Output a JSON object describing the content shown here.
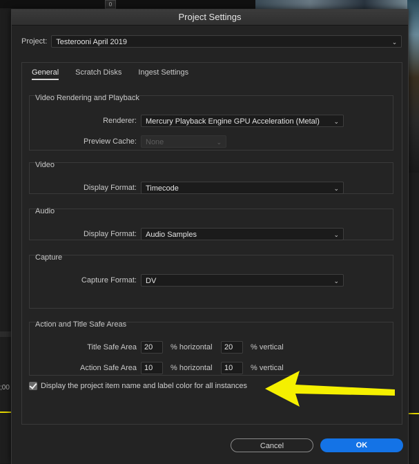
{
  "background": {
    "top_number": "0",
    "left_timecode": ";00"
  },
  "dialog": {
    "title": "Project Settings",
    "project_label": "Project:",
    "project_value": "Testerooni April 2019"
  },
  "tabs": [
    {
      "label": "General",
      "active": true
    },
    {
      "label": "Scratch Disks",
      "active": false
    },
    {
      "label": "Ingest Settings",
      "active": false
    }
  ],
  "video_rendering": {
    "title": "Video Rendering and Playback",
    "renderer_label": "Renderer:",
    "renderer_value": "Mercury Playback Engine GPU Acceleration (Metal)",
    "preview_cache_label": "Preview Cache:",
    "preview_cache_value": "None"
  },
  "video": {
    "title": "Video",
    "display_format_label": "Display Format:",
    "display_format_value": "Timecode"
  },
  "audio": {
    "title": "Audio",
    "display_format_label": "Display Format:",
    "display_format_value": "Audio Samples"
  },
  "capture": {
    "title": "Capture",
    "capture_format_label": "Capture Format:",
    "capture_format_value": "DV"
  },
  "safe_areas": {
    "title": "Action and Title Safe Areas",
    "title_safe_label": "Title Safe Area",
    "title_safe_h": "20",
    "title_safe_v": "20",
    "action_safe_label": "Action Safe Area",
    "action_safe_h": "10",
    "action_safe_v": "10",
    "horizontal_unit": "% horizontal",
    "vertical_unit": "% vertical"
  },
  "checkbox": {
    "label": "Display the project item name and label color for all instances",
    "checked": true
  },
  "buttons": {
    "cancel": "Cancel",
    "ok": "OK"
  },
  "colors": {
    "accent": "#1473e6",
    "annotation_arrow": "#f5f000"
  }
}
